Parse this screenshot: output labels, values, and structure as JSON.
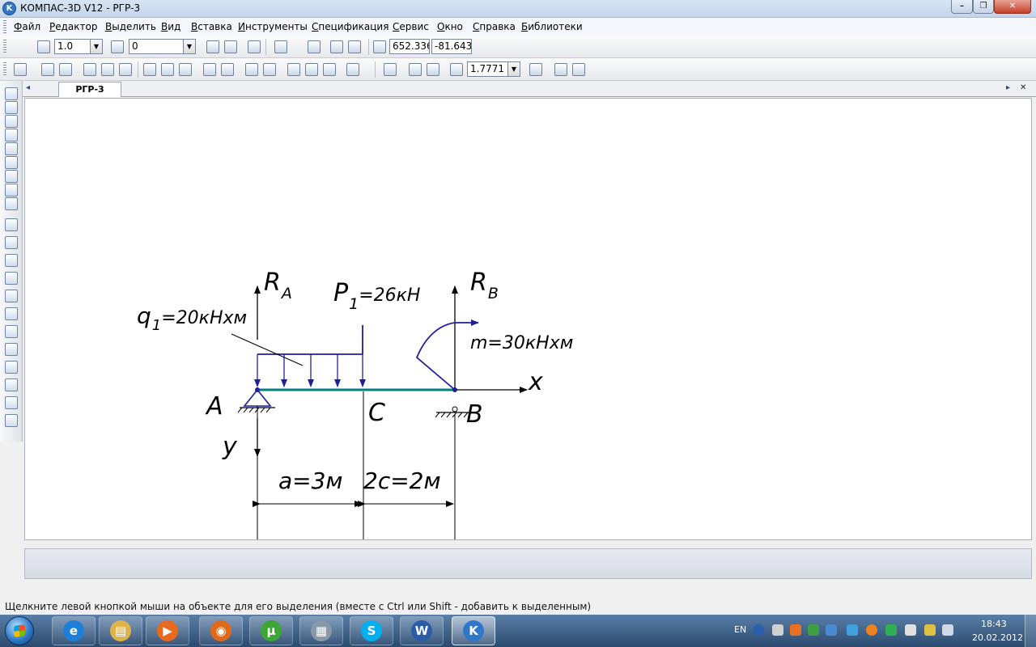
{
  "window": {
    "title": "КОМПАС-3D V12 - РГР-3",
    "app_icon_letter": "K",
    "min_glyph": "–",
    "restore_glyph": "❐",
    "close_glyph": "✕"
  },
  "menu": [
    "Файл",
    "Редактор",
    "Выделить",
    "Вид",
    "Вставка",
    "Инструменты",
    "Спецификация",
    "Сервис",
    "Окно",
    "Справка",
    "Библиотеки"
  ],
  "toolbar": {
    "step": "1.0",
    "layer": "0",
    "coord_x": "652.336",
    "coord_y": "-81.643",
    "zoom": "1.7771",
    "dropdown_glyph": "▼"
  },
  "document": {
    "tab": "РГР-3",
    "tab_left_glyph": "◂",
    "tab_right_glyph": "▸",
    "tab_close_glyph": "✕"
  },
  "drawing": {
    "label_RA": "R",
    "label_RA_sub": "A",
    "label_P1": "P",
    "label_P1_sub": "1",
    "label_P1_value": "=26кН",
    "label_RB": "R",
    "label_RB_sub": "B",
    "label_q1": "q",
    "label_q1_sub": "1",
    "label_q1_value": "=20кНхм",
    "label_m": "m=30кНхм",
    "label_A": "A",
    "label_C": "C",
    "label_B": "B",
    "label_x": "x",
    "label_y": "y",
    "dim_a": "a=3м",
    "dim_2c": "2c=2м",
    "colors": {
      "beam": "#008080",
      "load": "#1e1ea0",
      "ink": "#000000"
    }
  },
  "status": "Щелкните левой кнопкой мыши на объекте для его выделения (вместе с Ctrl или Shift - добавить к выделенным)",
  "taskbar": {
    "apps": [
      {
        "name": "internet-explorer-icon",
        "glyph": "e",
        "color": "#1e7fd8"
      },
      {
        "name": "explorer-icon",
        "glyph": "▤",
        "color": "#e0b24a"
      },
      {
        "name": "media-player-icon",
        "glyph": "▶",
        "color": "#e86a1c"
      },
      {
        "name": "firefox-icon",
        "glyph": "◉",
        "color": "#e06a1a"
      },
      {
        "name": "utorrent-icon",
        "glyph": "µ",
        "color": "#3fa535"
      },
      {
        "name": "calculator-icon",
        "glyph": "▦",
        "color": "#8898a8"
      },
      {
        "name": "skype-icon",
        "glyph": "S",
        "color": "#00aff0"
      },
      {
        "name": "word-icon",
        "glyph": "W",
        "color": "#2a5caa"
      },
      {
        "name": "kompas-icon",
        "glyph": "K",
        "color": "#2f78c9"
      }
    ],
    "lang": "EN",
    "time": "18:43",
    "date": "20.02.2012"
  }
}
